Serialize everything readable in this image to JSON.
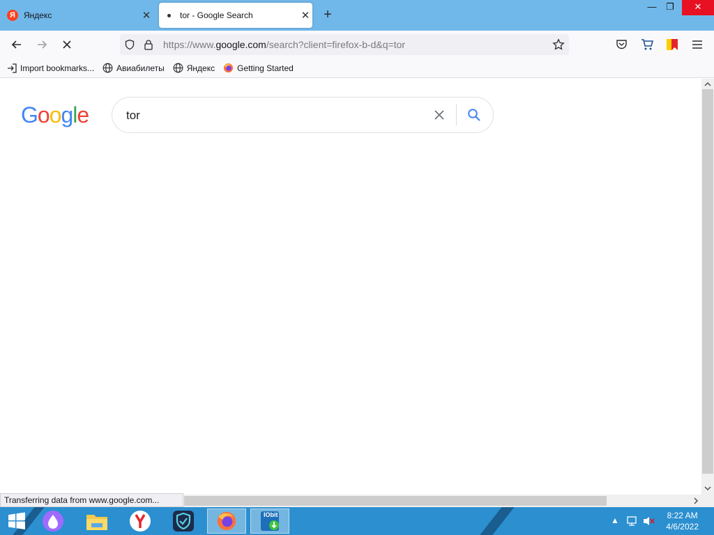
{
  "tabs": [
    {
      "label": "Яндекс",
      "favicon": "yandex-icon",
      "active": false
    },
    {
      "label": "tor - Google Search",
      "favicon": "loading-dot-icon",
      "active": true
    }
  ],
  "window_controls": {
    "minimize": "—",
    "restore": "❐",
    "close": "✕"
  },
  "url": {
    "prefix": "https://www.",
    "host": "google.com",
    "path": "/search?client=firefox-b-d&q=tor"
  },
  "bookmarks": [
    {
      "label": "Import bookmarks...",
      "icon": "import-icon"
    },
    {
      "label": "Авиабилеты",
      "icon": "globe-icon"
    },
    {
      "label": "Яндекс",
      "icon": "globe-icon"
    },
    {
      "label": "Getting Started",
      "icon": "firefox-icon"
    }
  ],
  "google": {
    "logo_letters": [
      "G",
      "o",
      "o",
      "g",
      "l",
      "e"
    ],
    "logo_colors": [
      "#4285f4",
      "#ea4335",
      "#fbbc05",
      "#4285f4",
      "#34a853",
      "#ea4335"
    ],
    "query": "tor"
  },
  "status_text": "Transferring data from www.google.com...",
  "taskbar": {
    "icons": [
      "windows-start-icon",
      "alice-assistant-icon",
      "file-explorer-icon",
      "yandex-browser-icon",
      "vpn-shield-icon",
      "firefox-icon",
      "iobit-icon"
    ],
    "iobit_label": "IObit",
    "time": "8:22 AM",
    "date": "4/6/2022"
  },
  "colors": {
    "tabstrip": "#71b8ea",
    "taskbar": "#2b8fd0",
    "accent_blue": "#4285f4"
  }
}
